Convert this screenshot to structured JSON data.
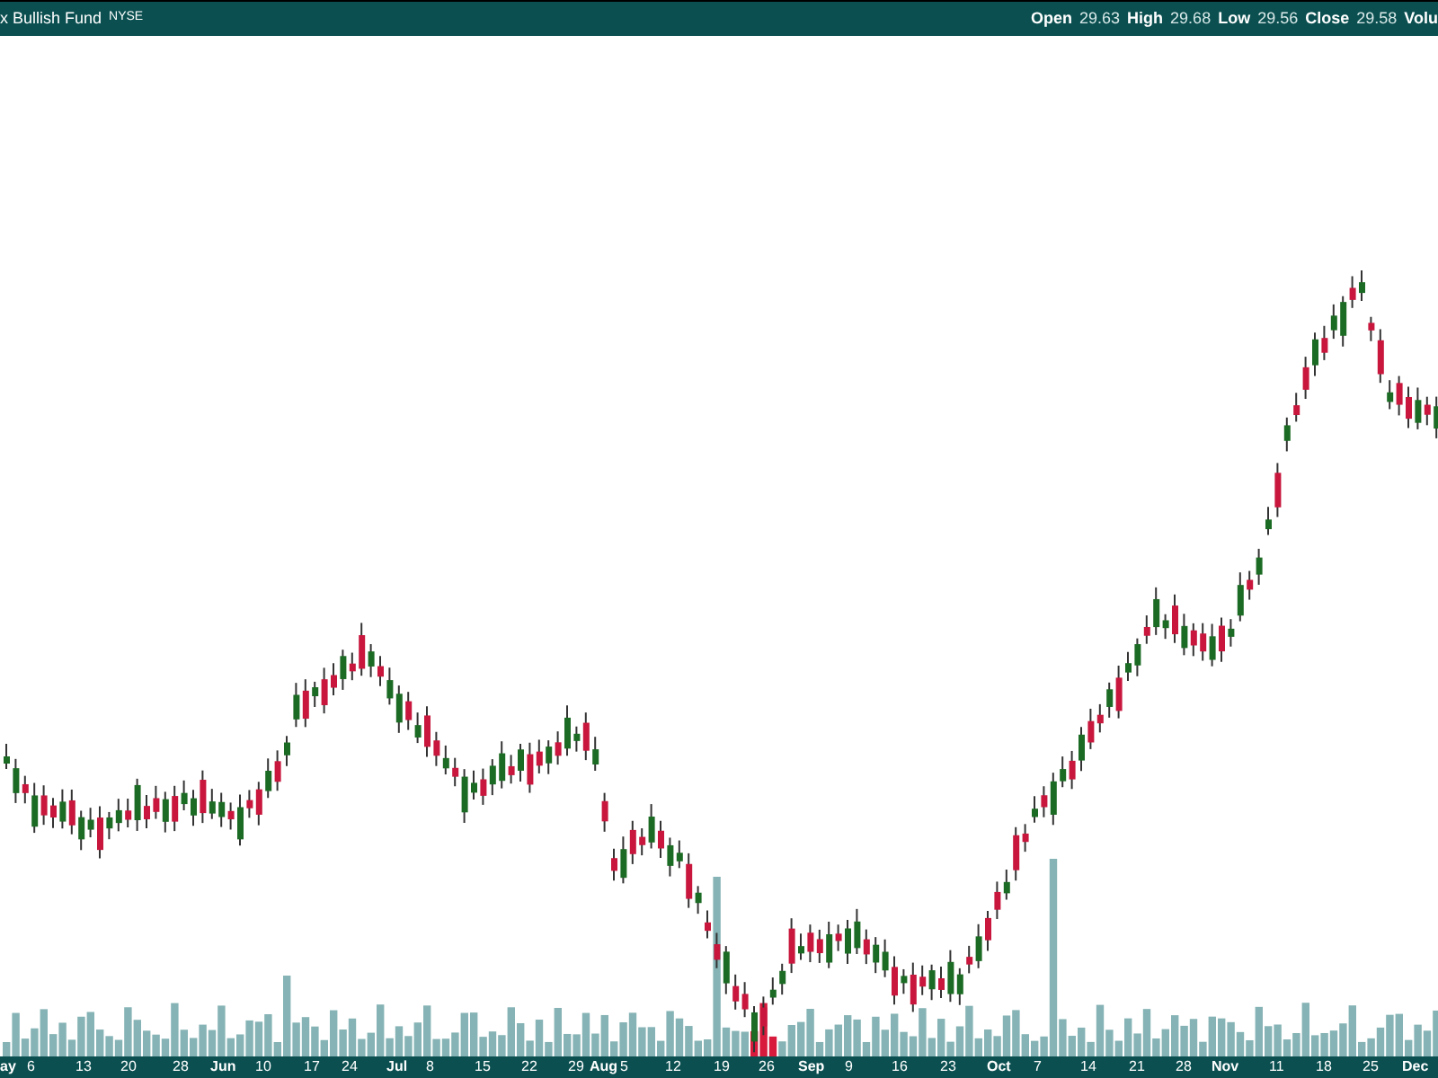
{
  "header": {
    "title": "x Bullish Fund",
    "exchange": "NYSE",
    "quote": [
      {
        "label": "Open",
        "value": "29.63"
      },
      {
        "label": "High",
        "value": "29.68"
      },
      {
        "label": "Low",
        "value": "29.56"
      },
      {
        "label": "Close",
        "value": "29.58"
      },
      {
        "label": "Volu"
      }
    ]
  },
  "x_axis": [
    {
      "text": "ay",
      "kind": "month"
    },
    {
      "text": "6",
      "kind": "day"
    },
    {
      "text": "13",
      "kind": "day"
    },
    {
      "text": "20",
      "kind": "day"
    },
    {
      "text": "28",
      "kind": "day"
    },
    {
      "text": "Jun",
      "kind": "month"
    },
    {
      "text": "10",
      "kind": "day"
    },
    {
      "text": "17",
      "kind": "day"
    },
    {
      "text": "24",
      "kind": "day"
    },
    {
      "text": "Jul",
      "kind": "month"
    },
    {
      "text": "8",
      "kind": "day"
    },
    {
      "text": "15",
      "kind": "day"
    },
    {
      "text": "22",
      "kind": "day"
    },
    {
      "text": "29",
      "kind": "day"
    },
    {
      "text": "Aug",
      "kind": "month"
    },
    {
      "text": "5",
      "kind": "day"
    },
    {
      "text": "12",
      "kind": "day"
    },
    {
      "text": "19",
      "kind": "day"
    },
    {
      "text": "26",
      "kind": "day"
    },
    {
      "text": "Sep",
      "kind": "month"
    },
    {
      "text": "9",
      "kind": "day"
    },
    {
      "text": "16",
      "kind": "day"
    },
    {
      "text": "23",
      "kind": "day"
    },
    {
      "text": "Oct",
      "kind": "month"
    },
    {
      "text": "7",
      "kind": "day"
    },
    {
      "text": "14",
      "kind": "day"
    },
    {
      "text": "21",
      "kind": "day"
    },
    {
      "text": "28",
      "kind": "day"
    },
    {
      "text": "Nov",
      "kind": "month"
    },
    {
      "text": "11",
      "kind": "day"
    },
    {
      "text": "18",
      "kind": "day"
    },
    {
      "text": "25",
      "kind": "day"
    },
    {
      "text": "Dec",
      "kind": "month"
    }
  ]
}
